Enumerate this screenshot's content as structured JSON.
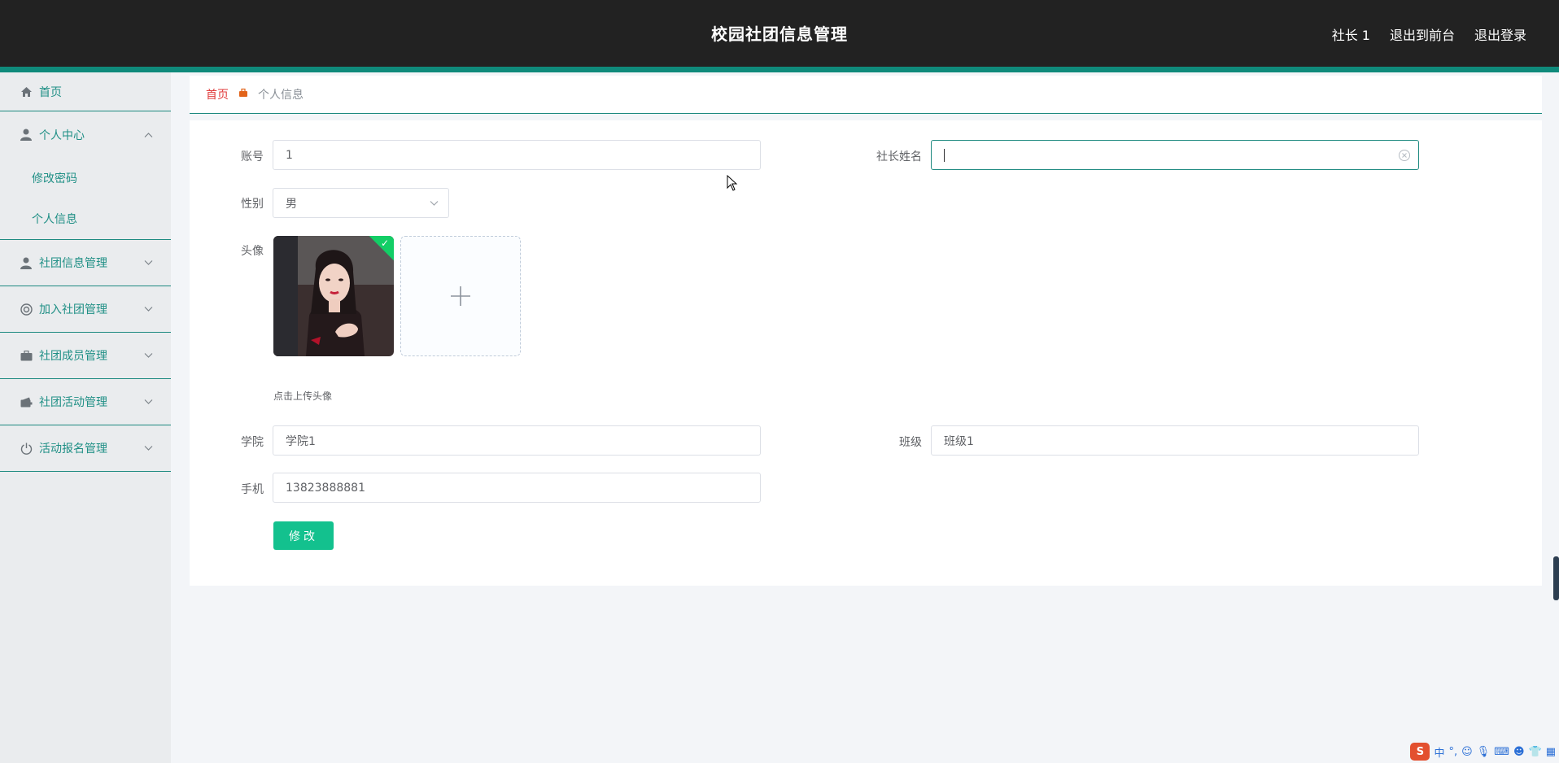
{
  "header": {
    "title": "校园社团信息管理",
    "links": [
      "社长 1",
      "退出到前台",
      "退出登录"
    ]
  },
  "sidebar": {
    "home": "首页",
    "personal_center": "个人中心",
    "personal_sub": [
      "修改密码",
      "个人信息"
    ],
    "groups": [
      "社团信息管理",
      "加入社团管理",
      "社团成员管理",
      "社团活动管理",
      "活动报名管理"
    ]
  },
  "breadcrumb": {
    "home": "首页",
    "current": "个人信息"
  },
  "form": {
    "account_label": "账号",
    "account_value": "1",
    "president_name_label": "社长姓名",
    "president_name_value": "",
    "gender_label": "性别",
    "gender_value": "男",
    "avatar_label": "头像",
    "upload_tip": "点击上传头像",
    "college_label": "学院",
    "college_value": "学院1",
    "class_label": "班级",
    "class_value": "班级1",
    "phone_label": "手机",
    "phone_value": "13823888881",
    "submit_label": "修改"
  },
  "ime": {
    "logo": "S",
    "mode": "中"
  },
  "colors": {
    "header_bg": "#222222",
    "accent": "#0f8a7b",
    "submit": "#13c18e",
    "breadcrumb_home": "#e03a3a"
  }
}
